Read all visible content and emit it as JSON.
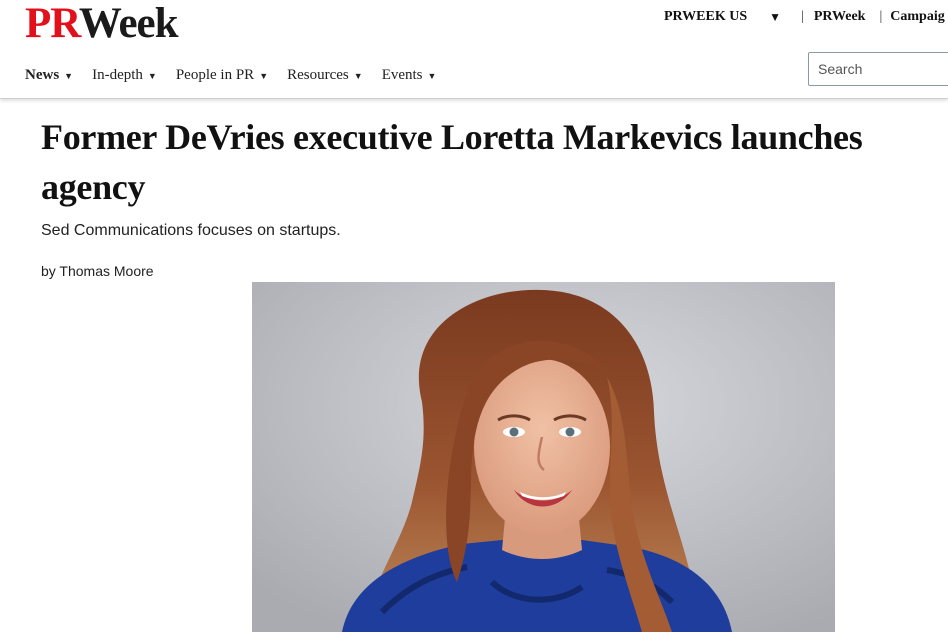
{
  "header": {
    "logo_pr": "PR",
    "logo_week": "Week",
    "edition": "PRWEEK US",
    "edition_caret": "▼",
    "links": [
      {
        "label": "PRWeek"
      },
      {
        "label": "Campaig"
      }
    ],
    "separator": "|"
  },
  "nav": {
    "items": [
      {
        "label": "News",
        "caret": "▼"
      },
      {
        "label": "In-depth",
        "caret": "▼"
      },
      {
        "label": "People in PR",
        "caret": "▼"
      },
      {
        "label": "Resources",
        "caret": "▼"
      },
      {
        "label": "Events",
        "caret": "▼"
      }
    ]
  },
  "search": {
    "placeholder": "Search"
  },
  "article": {
    "headline": "Former DeVries executive Loretta Markevics launches agency",
    "standfirst": "Sed Communications focuses on startups.",
    "byline": "by Thomas Moore"
  },
  "image": {
    "subject": "portrait of smiling woman with long auburn wavy hair in a royal blue blouse against a grey backdrop"
  },
  "colors": {
    "brand_red": "#e2101a",
    "text": "#111111",
    "blouse_blue": "#1f3d9c"
  }
}
